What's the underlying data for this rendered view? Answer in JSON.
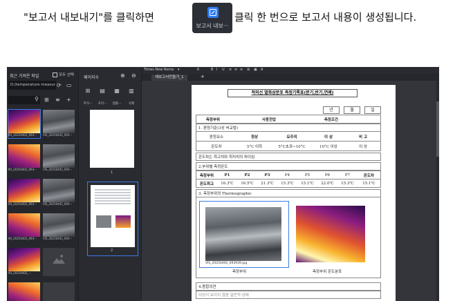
{
  "instruction": {
    "before": "\"보고서 내보내기\"를 클릭하면",
    "after": "클릭 한 번으로 보고서 내용이 생성됩니다.",
    "button_label": "보고서 내보···"
  },
  "left_panel": {
    "title": "최근 가져온 파일",
    "select_all": "모두 선택",
    "path": "D:/temperature measur",
    "thumbs": [
      {
        "caption": "IRI_20250402_093···",
        "style": "ir",
        "selected": true
      },
      {
        "caption": "VIS_20250402_093···",
        "style": "gray"
      },
      {
        "caption": "IRI_20250402_093···",
        "style": "ir2"
      },
      {
        "caption": "VIS_20250402_093···",
        "style": "gray"
      },
      {
        "caption": "IRI_20250402_093···",
        "style": "ir"
      },
      {
        "caption": "VIS_20250402_093···",
        "style": "gray"
      },
      {
        "caption": "IRI_20250402_093···",
        "style": "ir2"
      },
      {
        "caption": "VIS_20250402_093···",
        "style": "gray"
      },
      {
        "caption": "IRI_20250402_···",
        "style": "ir"
      },
      {
        "caption": "",
        "style": "placeholder"
      }
    ]
  },
  "pages_panel": {
    "title": "페이지수",
    "tools": [
      "추가···",
      "호리···",
      "템플···",
      "삭제"
    ],
    "page1_num": "1",
    "page2_num": "2"
  },
  "editor": {
    "font": "Times New Roma",
    "size": "6",
    "tab": "새보고서만들기_1",
    "doc": {
      "title": "적외선 열화상분포 측정기록표(분기,반기,연례)",
      "year": "년",
      "month": "월",
      "day": "일",
      "info_headers": [
        "측정부위",
        "사용전압",
        "측정조건"
      ],
      "sec1": "1. 판정기준(3상 비교법)",
      "criteria_headers": [
        "판정요소",
        "정상",
        "요주의",
        "이 상",
        "비 고"
      ],
      "criteria_values": [
        "온도차",
        "5°C 이하",
        "5°C초과~10°C",
        "10°C 이상",
        "이 상"
      ],
      "note": "온도차는 최고치와 최저치의 차이임",
      "sec2": "2.부위별 측정온도",
      "temp_headers": [
        "측정부위",
        "P1",
        "P2",
        "P3",
        "P4",
        "P5",
        "P6",
        "P7",
        "온도차"
      ],
      "temp_values": [
        "온도최고",
        "16.3℃",
        "16.5℃",
        "21.3℃",
        "15.3℃",
        "15.1℃",
        "22.0℃",
        "15.3℃",
        "15.1℃"
      ],
      "sec3": "3. 측정부위의 Thermographic",
      "visible_file": "VIS_20250402_093939.jpg",
      "caption_visible": "측정부위",
      "caption_ir": "측정부위 온도분포",
      "sec4": "4.종합의견",
      "sec4_note": "이상이 보이지 않음 일반적 상태"
    }
  }
}
